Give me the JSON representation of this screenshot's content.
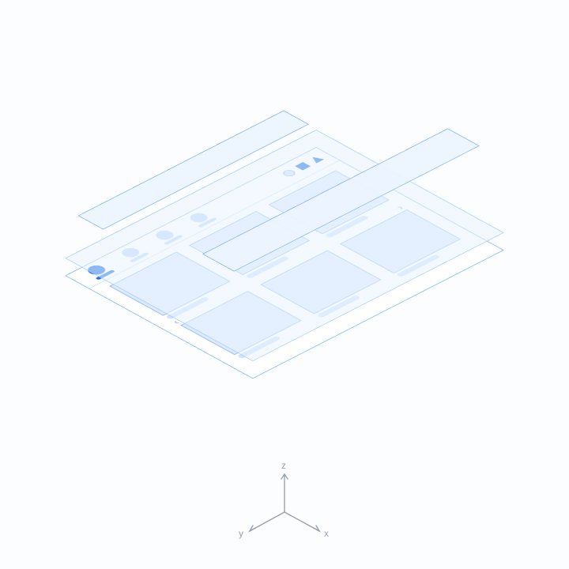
{
  "diagram": {
    "concept": "isometric-layered-ui-surface",
    "axes": {
      "x": "x",
      "y": "y",
      "z": "z"
    },
    "colors": {
      "stroke": "#6ea8ff",
      "fill_light": "#dcebff",
      "fill_pale": "#eaf2ff",
      "accent": "#1a73e8",
      "axis": "#98a2b3"
    },
    "tabs": [
      {
        "id": "tab-1",
        "active": true
      },
      {
        "id": "tab-2",
        "active": false
      },
      {
        "id": "tab-3",
        "active": false
      },
      {
        "id": "tab-4",
        "active": false
      }
    ],
    "window_controls": [
      "circle",
      "square",
      "triangle"
    ],
    "cards": {
      "rows": 2,
      "cols": 3
    },
    "pager": {
      "prev": "‹",
      "next": "›"
    },
    "floating_layers": [
      {
        "id": "top-strip",
        "z_order": 1
      },
      {
        "id": "dock-bar",
        "z_order": 2
      }
    ]
  }
}
